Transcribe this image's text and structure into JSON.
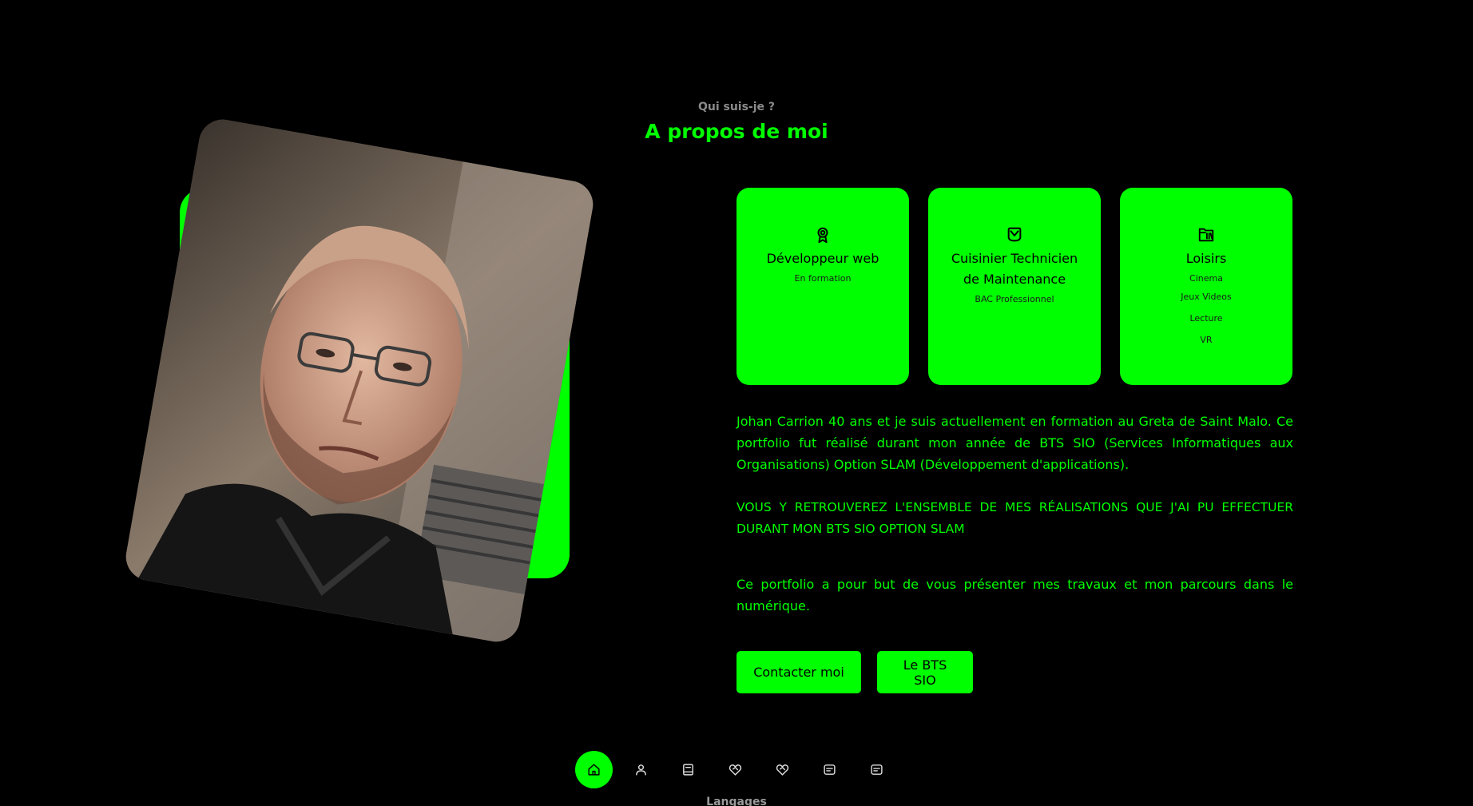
{
  "header": {
    "subtitle": "Qui suis-je ?",
    "title": "A propos de moi"
  },
  "cards": [
    {
      "icon": "award-icon",
      "title": "Développeur web",
      "subs": [
        "En formation"
      ]
    },
    {
      "icon": "chef-icon",
      "title": "Cuisinier Technicien de Maintenance",
      "subs": [
        "BAC Professionnel"
      ]
    },
    {
      "icon": "library-icon",
      "title": "Loisirs",
      "subs": [
        "Cinema",
        "Jeux Videos",
        "Lecture",
        "VR"
      ]
    }
  ],
  "about": {
    "p1": "Johan Carrion 40 ans et je suis actuellement en formation au Greta de Saint Malo. Ce portfolio fut réalisé durant mon année de BTS SIO (Services Informatiques aux Organisations) Option SLAM (Développement d'applications).",
    "p2": "VOUS Y RETROUVEREZ L'ENSEMBLE DE MES RÉALISATIONS QUE J'AI PU EFFECTUER DURANT MON BTS SIO OPTION SLAM",
    "p3": "Ce portfolio a pour but de vous présenter mes travaux et mon parcours dans le numérique."
  },
  "buttons": {
    "contact": "Contacter moi",
    "bts": "Le BTS SIO"
  },
  "nav": {
    "items": [
      "home-icon",
      "user-icon",
      "book-icon",
      "heart-handshake-icon",
      "heart-handshake-icon",
      "message-icon",
      "message-icon"
    ],
    "active_index": 0
  },
  "next_section": "Langages",
  "colors": {
    "accent": "#00ff00",
    "background": "#000000",
    "muted": "#8a8a8a"
  }
}
